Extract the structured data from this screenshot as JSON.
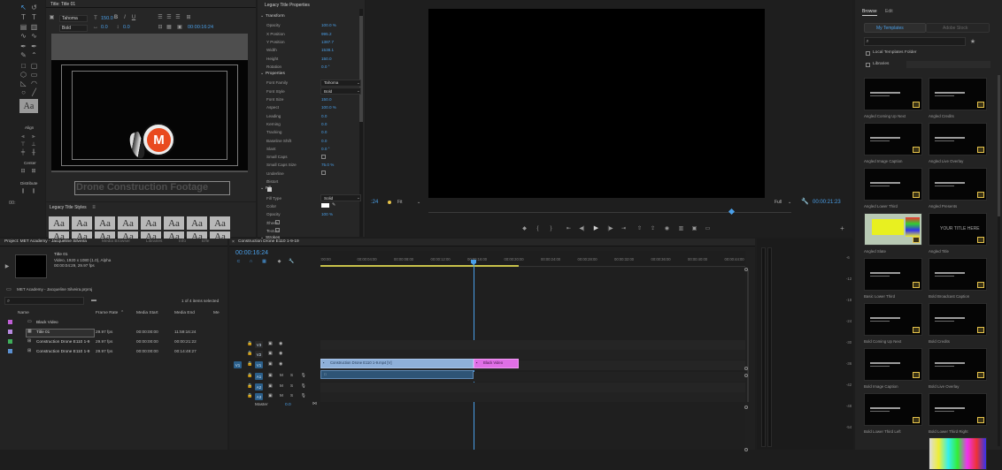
{
  "title_tool": {
    "panel_title": "Title: Title 01",
    "font_family": "Tahoma",
    "font_style": "Bold",
    "size": "150.0",
    "kerning": "0.0",
    "leading": "0.0",
    "timecode": "00:00:16:24",
    "title_text": "Drone Construction Footage",
    "logo_letter": "M",
    "side_tc": "00:",
    "align_label": "Align",
    "center_label": "Center",
    "distribute_label": "Distribute",
    "aa_label": "Aa"
  },
  "styles": {
    "title": "Legacy Title Styles",
    "items": [
      "Aa",
      "Aa",
      "Aa",
      "Aa",
      "Aa",
      "Aa",
      "Aa",
      "Aa",
      "Aa",
      "Aa",
      "Aa",
      "Aa",
      "Aa",
      "Aa",
      "Aa",
      "Aa"
    ]
  },
  "properties": {
    "title": "Legacy Title Properties",
    "transform_label": "Transform",
    "transform": [
      {
        "name": "Opacity",
        "value": "100.0 %"
      },
      {
        "name": "X Position",
        "value": "995.2"
      },
      {
        "name": "Y Position",
        "value": "1387.7"
      },
      {
        "name": "Width",
        "value": "1538.1"
      },
      {
        "name": "Height",
        "value": "150.0"
      },
      {
        "name": "Rotation",
        "value": "0.0 °"
      }
    ],
    "props_label": "Properties",
    "props": [
      {
        "name": "Font Family",
        "value": "Tahoma"
      },
      {
        "name": "Font Style",
        "value": "Bold"
      },
      {
        "name": "Font Size",
        "value": "150.0"
      },
      {
        "name": "Aspect",
        "value": "100.0 %"
      },
      {
        "name": "Leading",
        "value": "0.0"
      },
      {
        "name": "Kerning",
        "value": "0.0"
      },
      {
        "name": "Tracking",
        "value": "0.0"
      },
      {
        "name": "Baseline Shift",
        "value": "0.0"
      },
      {
        "name": "Slant",
        "value": "0.0 °"
      },
      {
        "name": "Small Caps",
        "value": ""
      },
      {
        "name": "Small Caps Size",
        "value": "75.0 %"
      },
      {
        "name": "Underline",
        "value": ""
      },
      {
        "name": "Distort",
        "value": ""
      }
    ],
    "fill_label": "Fill",
    "fill": [
      {
        "name": "Fill Type",
        "value": "Solid"
      },
      {
        "name": "Color",
        "value": ""
      },
      {
        "name": "Opacity",
        "value": "100 %"
      },
      {
        "name": "Sheen",
        "value": ""
      },
      {
        "name": "Texture",
        "value": ""
      }
    ],
    "strokes_label": "Strokes"
  },
  "monitor": {
    "tc_left": ":24",
    "fit": "Fit",
    "full": "Full",
    "tc_right": "00:00:21:23"
  },
  "browse": {
    "tabs": [
      "Browse",
      "Edit"
    ],
    "my_templates": "My Templates",
    "adobe_stock": "Adobe Stock",
    "local_templates": "Local Templates Folder",
    "libraries": "Libraries",
    "templates": [
      "Angled Coming Up Next",
      "Angled Credits",
      "Angled Image Caption",
      "Angled Live Overlay",
      "Angled Lower Third",
      "Angled Presents",
      "Angled Slate",
      "Angled Title",
      "Basic Lower Third",
      "Bold Broadcast Caption",
      "Bold Coming Up Next",
      "Bold Credits",
      "Bold Image Caption",
      "Bold Live Overlay",
      "Bold Lower Third Left",
      "Bold Lower Third Right"
    ],
    "title_thumb_text": "YOUR TITLE HERE"
  },
  "project": {
    "tabs": [
      "Project: MET Academy - Jacqueline Silveira",
      "Media Browser",
      "Libraries",
      "Info",
      "Effe"
    ],
    "clip_name": "Title 01",
    "clip_info": "Video, 1920 x 1080 (1.0), Alpha",
    "clip_info2": "00:00:04:29, 29.97 fps",
    "path": "MET Academy - Jacqueline Silveira.prproj",
    "count": "1 of 4 items selected",
    "columns": [
      "Name",
      "Frame Rate",
      "Media Start",
      "Media End",
      "Me"
    ],
    "rows": [
      {
        "name": "Black Video",
        "fps": "",
        "start": "",
        "end": "",
        "color": "#c05fd6"
      },
      {
        "name": "Title 01",
        "fps": "29.97 fps",
        "start": "00:00:00:00",
        "end": "11:59:16:24",
        "color": "#b88ae0"
      },
      {
        "name": "Construction Drone E110 1-9",
        "fps": "29.97 fps",
        "start": "00:00:00:00",
        "end": "00:00:21:22",
        "color": "#3fae5a"
      },
      {
        "name": "Construction Drone E110 1-9",
        "fps": "29.97 fps",
        "start": "00:00:00:00",
        "end": "00:14:49:27",
        "color": "#5b8fd0"
      }
    ]
  },
  "timeline": {
    "tab": "Construction Drone E110 1-9-19",
    "tc": "00:00:16:24",
    "ruler": [
      ":00:00",
      "00:00:04:00",
      "00:00:08:00",
      "00:00:12:00",
      "00:00:16:00",
      "00:00:20:00",
      "00:00:24:00",
      "00:00:28:00",
      "00:00:32:00",
      "00:00:36:00",
      "00:00:40:00",
      "00:00:44:00"
    ],
    "video_tracks": [
      "V3",
      "V2",
      "V1"
    ],
    "audio_tracks": [
      "A1",
      "A2",
      "A3"
    ],
    "master": "Master",
    "master_val": "0.0",
    "v1_src": "V1",
    "a1_src": "A1",
    "clip1": "Construction Drone E110 1-9.mp4 [V]",
    "clip2": "Black Video",
    "meter": [
      "-6",
      "-12",
      "-18",
      "-24",
      "-30",
      "-36",
      "-42",
      "-48",
      "-54"
    ]
  }
}
